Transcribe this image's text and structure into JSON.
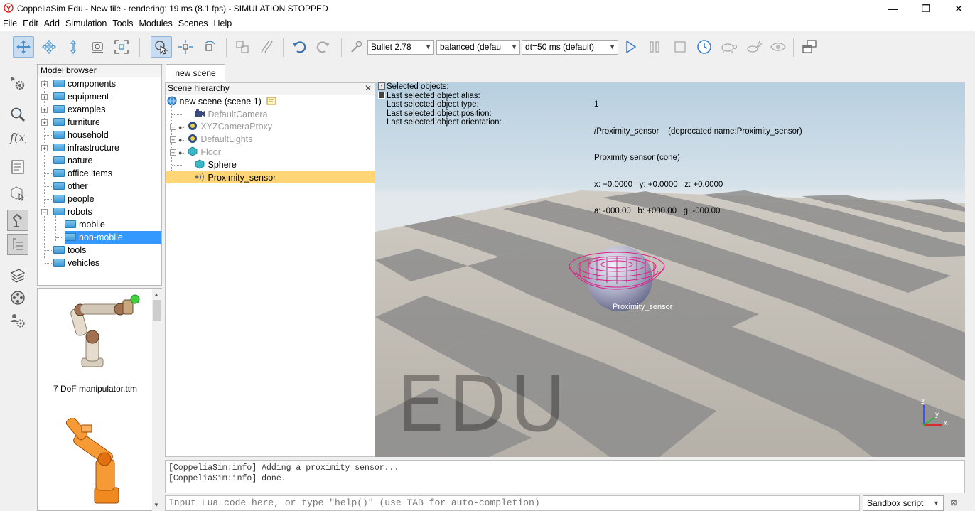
{
  "window": {
    "title": "CoppeliaSim Edu - New file - rendering: 19 ms (8.1 fps) - SIMULATION STOPPED",
    "minimize": "—",
    "maximize": "❐",
    "close": "✕"
  },
  "menu": [
    "File",
    "Edit",
    "Add",
    "Simulation",
    "Tools",
    "Modules",
    "Scenes",
    "Help"
  ],
  "toolbar": {
    "engine": "Bullet 2.78",
    "accuracy": "balanced (defau",
    "timestep": "dt=50 ms (default)"
  },
  "model_browser": {
    "header": "Model browser",
    "items": [
      {
        "label": "components"
      },
      {
        "label": "equipment"
      },
      {
        "label": "examples"
      },
      {
        "label": "furniture"
      },
      {
        "label": "household"
      },
      {
        "label": "infrastructure"
      },
      {
        "label": "nature"
      },
      {
        "label": "office items"
      },
      {
        "label": "other"
      },
      {
        "label": "people"
      },
      {
        "label": "robots"
      },
      {
        "label": "mobile"
      },
      {
        "label": "non-mobile"
      },
      {
        "label": "tools"
      },
      {
        "label": "vehicles"
      }
    ],
    "selected": "non-mobile"
  },
  "thumbnails": [
    {
      "label": "7 DoF manipulator.ttm"
    }
  ],
  "tab": {
    "label": "new scene"
  },
  "scene_hierarchy": {
    "header": "Scene hierarchy",
    "close": "✕",
    "items": [
      {
        "label": "new scene (scene 1)"
      },
      {
        "label": "DefaultCamera"
      },
      {
        "label": "XYZCameraProxy"
      },
      {
        "label": "DefaultLights"
      },
      {
        "label": "Floor"
      },
      {
        "label": "Sphere"
      },
      {
        "label": "Proximity_sensor"
      }
    ]
  },
  "info_overlay": {
    "labels": [
      "Selected objects:",
      "Last selected object alias:",
      "Last selected object type:",
      "Last selected object position:",
      "Last selected object orientation:"
    ],
    "values": [
      "1",
      "/Proximity_sensor    (deprecated name:Proximity_sensor)",
      "Proximity sensor (cone)",
      "x: +0.0000   y: +0.0000   z: +0.0000",
      "a: -000.00   b: +000.00   g: -000.00"
    ]
  },
  "viewport": {
    "object_label": "Proximity_sensor",
    "watermark": "EDU",
    "axes": {
      "z": "z",
      "y": "y",
      "x": "x"
    }
  },
  "console": {
    "lines": [
      "[CoppeliaSim:info] Adding a proximity sensor...",
      "[CoppeliaSim:info] done."
    ]
  },
  "lua_input": {
    "placeholder": "Input Lua code here, or type \"help()\" (use TAB for auto-completion)"
  },
  "script_mode": {
    "label": "Sandbox script",
    "close": "⊠"
  },
  "colors": {
    "selection": "#ffd575",
    "tree_selection": "#3399ff",
    "sensor": "#e0208a"
  }
}
